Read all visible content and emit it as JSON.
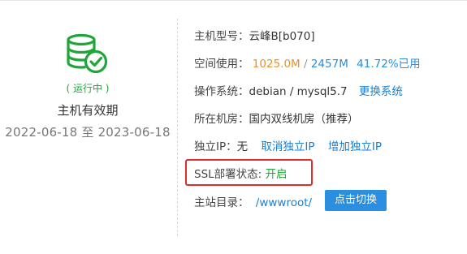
{
  "host": {
    "status": "( 运行中 )",
    "validity_label": "主机有效期",
    "start_date": "2022-06-18",
    "date_separator": "至",
    "end_date": "2023-06-18"
  },
  "info": {
    "model_label": "主机型号：",
    "model_value": "云峰B[b070]",
    "space_label": "空间使用：",
    "space_used": "1025.0M",
    "space_sep": "/",
    "space_total": "2457M",
    "space_pct": "41.72%已用",
    "os_label": "操作系统：",
    "os_value": "debian / mysql5.7",
    "os_change": "更换系统",
    "room_label": "所在机房：",
    "room_value": "国内双线机房（推荐）",
    "ip_label": "独立IP：",
    "ip_value": "无",
    "ip_cancel": "取消独立IP",
    "ip_add": "增加独立IP",
    "ssl_label": "SSL部署状态:",
    "ssl_value": "开启",
    "dir_label": "主站目录：",
    "dir_value": "/wwwroot/",
    "dir_button": "点击切换"
  },
  "colors": {
    "running_green": "#20a53a",
    "used_orange": "#e5932b",
    "total_blue": "#2b8fd8",
    "link_blue": "#1b7fd4",
    "button_blue": "#2a8fe0",
    "highlight_red": "#e12c2c"
  },
  "icons": {
    "host": "database-check-icon"
  }
}
